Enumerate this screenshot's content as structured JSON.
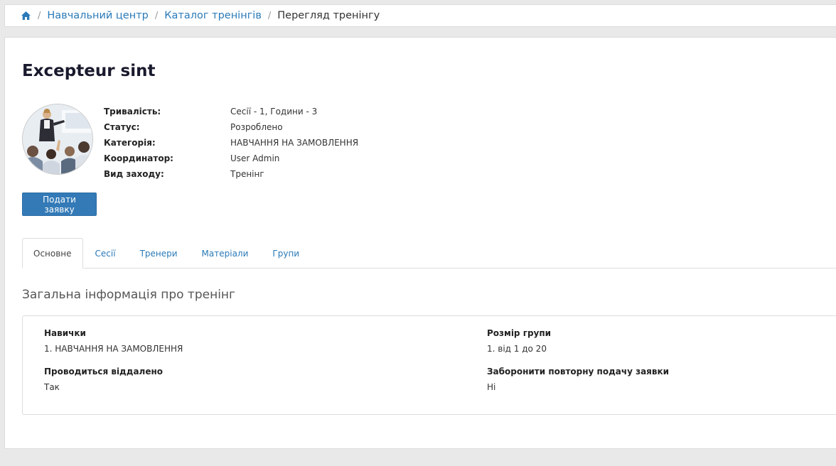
{
  "breadcrumb": {
    "home_icon": "home-icon",
    "items": [
      "Навчальний центр",
      "Каталог тренінгів"
    ],
    "current": "Перегляд тренінгу",
    "separator": "/"
  },
  "training": {
    "title": "Excepteur sint",
    "image": "presentation-photo",
    "info": [
      {
        "label": "Тривалість:",
        "value": "Сесії - 1, Години - 3"
      },
      {
        "label": "Статус:",
        "value": "Розроблено"
      },
      {
        "label": "Категорія:",
        "value": "НАВЧАННЯ НА ЗАМОВЛЕННЯ"
      },
      {
        "label": "Координатор:",
        "value": "User Admin"
      },
      {
        "label": "Вид заходу:",
        "value": "Тренінг"
      }
    ],
    "apply_label": "Подати заявку"
  },
  "tabs": [
    "Основне",
    "Сесії",
    "Тренери",
    "Матеріали",
    "Групи"
  ],
  "active_tab": "Основне",
  "general": {
    "title": "Загальна інформація про тренінг",
    "fields": [
      {
        "label": "Навички",
        "value": "1. НАВЧАННЯ НА ЗАМОВЛЕННЯ"
      },
      {
        "label": "Розмір групи",
        "value": "1. від 1 до 20"
      },
      {
        "label": "Проводиться віддалено",
        "value": "Так"
      },
      {
        "label": "Заборонити повторну подачу заявки",
        "value": "Ні"
      }
    ]
  },
  "colors": {
    "link": "#2a7ab8",
    "primary_button": "#337ab7",
    "background": "#e9e9e9"
  }
}
